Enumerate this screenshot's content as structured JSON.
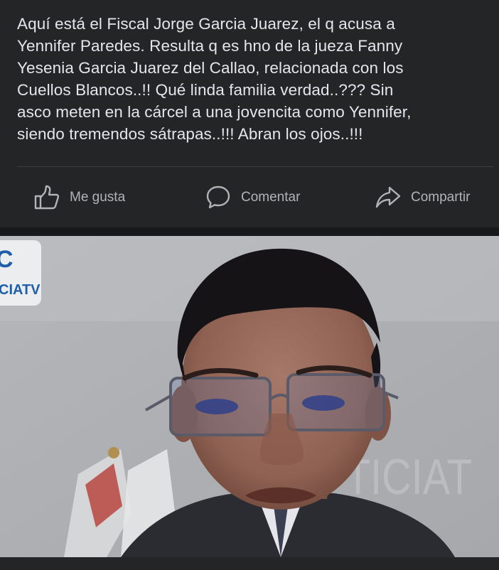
{
  "post": {
    "text_lines": [
      "Aquí está el Fiscal Jorge Garcia Juarez, el q acusa a",
      "Yennifer Paredes. Resulta q es hno de la jueza Fanny",
      "Yesenia Garcia Juarez del Callao, relacionada con los",
      "Cuellos Blancos..!! Qué linda familia verdad..??? Sin",
      "asco meten en la cárcel a una jovencita como Yennifer,",
      "siendo tremendos sátrapas..!!! Abran los ojos..!!!"
    ]
  },
  "actions": {
    "like": {
      "label": "Me gusta",
      "icon": "thumbs-up-icon"
    },
    "comment": {
      "label": "Comentar",
      "icon": "speech-bubble-icon"
    },
    "share": {
      "label": "Compartir",
      "icon": "share-arrow-icon"
    }
  },
  "photo": {
    "watermark_left": "CIATV",
    "watermark_right": "TICIAT"
  },
  "colors": {
    "background": "#242526",
    "text": "#e4e6eb",
    "secondary_text": "#b0b3b8",
    "divider": "#3e4042"
  }
}
